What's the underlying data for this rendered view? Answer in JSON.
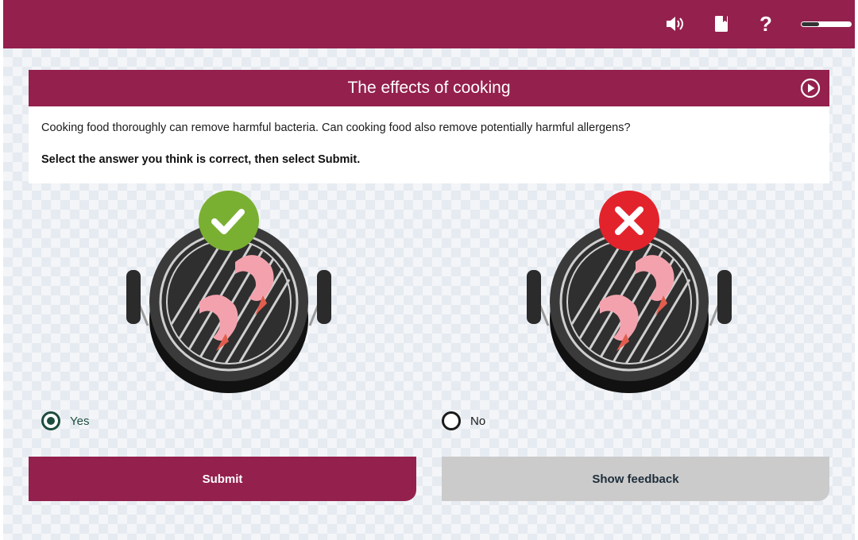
{
  "header": {
    "icons": [
      "speaker-icon",
      "bookmark-icon",
      "help-icon"
    ],
    "progress": 0.35
  },
  "card": {
    "title": "The effects of cooking",
    "question": "Cooking food thoroughly can remove harmful bacteria. Can cooking food also remove potentially harmful allergens?",
    "instruction": "Select the answer you think is correct, then select Submit."
  },
  "options": [
    {
      "label": "Yes",
      "selected": true,
      "badge": "check-icon",
      "badge_color": "#7ab032"
    },
    {
      "label": "No",
      "selected": false,
      "badge": "cross-icon",
      "badge_color": "#e3232c"
    }
  ],
  "buttons": {
    "submit": "Submit",
    "feedback": "Show feedback"
  },
  "colors": {
    "brand": "#94204d",
    "selected_radio": "#1d4d3e",
    "disabled_button": "#cbcbcb"
  }
}
